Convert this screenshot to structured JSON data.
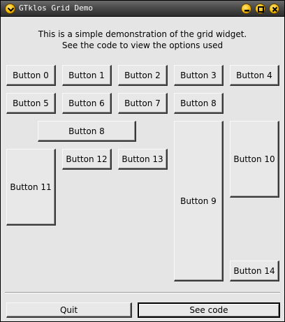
{
  "window": {
    "title": "GTklos Grid Demo"
  },
  "description": {
    "line1": "This is a simple demonstration of the grid widget.",
    "line2": "See the code to view the options used"
  },
  "grid": {
    "button_0": "Button 0",
    "button_1": "Button 1",
    "button_2": "Button 2",
    "button_3": "Button 3",
    "button_4": "Button 4",
    "button_5": "Button 5",
    "button_6": "Button 6",
    "button_7": "Button 7",
    "button_8a": "Button 8",
    "button_8b": "Button 8",
    "button_9": "Button 9",
    "button_10": "Button 10",
    "button_11": "Button 11",
    "button_12": "Button 12",
    "button_13": "Button 13",
    "button_14": "Button 14"
  },
  "actions": {
    "quit": "Quit",
    "see_code": "See code"
  },
  "colors": {
    "window_bg": "#e5e5e5",
    "titlebar": "#4a4a4a",
    "titlebar_buttons": "#f5b800"
  },
  "icons": {
    "menu": "chevron-down-icon",
    "minimize": "minimize-icon",
    "maximize": "maximize-icon",
    "close": "close-icon"
  }
}
